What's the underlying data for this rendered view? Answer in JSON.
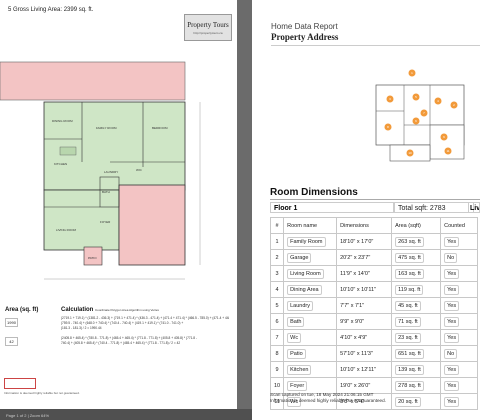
{
  "left_page": {
    "gla_text": "5 Gross Living Area: 2399 sq. ft.",
    "logo": {
      "title": "Property Tours",
      "url": "http://propertytours.ca"
    },
    "room_labels": [
      "DINING ROOM",
      "FAMILY ROOM",
      "BEDROOM",
      "KITCHEN",
      "W/C",
      "LAUNDRY",
      "BATH",
      "FOYER",
      "LIVING ROOM",
      "PATIO"
    ],
    "area_header": "Area (sq. ft)",
    "calc_header": "Calculation",
    "calc_subheader": "Coordinate Polygon Area Algorithm using Vertex",
    "areas": [
      {
        "value": "1990",
        "formula": "(2719.1 + 719.1) * (1381.2 - 436.3) + (719.1 + 471.4) * (436.3 - 471.4) + (471.4 + 471.4) * (466.5 - 785.0) + (471.4 + 448.4) * (785.0 - 785.0) + (448.4 + 542.8) * (785.9 - 785.9) + (542.8 + 542.8) *"
      },
      {
        "value": "42",
        "formula": "(2405.8 + 465.4) * (780.8 - 771.8) + (465.4 + 465.4) * (771.8 - 771.8) + (405.8 + 405.8) * (771.8 -"
      }
    ],
    "footnote": "Information is deemed highly reliable but not guaranteed.",
    "status_bar": "Page 1 of 2   |   Zoom 64%"
  },
  "right_page": {
    "subtitle": "Home Data Report",
    "title": "Property Address",
    "section_title": "Room Dimensions",
    "floor_label": "Floor 1",
    "total_label": "Total sqft:",
    "total_value": "2783",
    "liv_label": "Liv",
    "columns": [
      "#",
      "Room name",
      "Dimensions",
      "Area (sqft)",
      "Counted"
    ],
    "rooms": [
      {
        "n": "1",
        "name": "Family Room",
        "dim": "18'10\" x 17'0\"",
        "area": "263 sq. ft",
        "counted": "Yes"
      },
      {
        "n": "2",
        "name": "Garage",
        "dim": "20'2\" x 23'7\"",
        "area": "475 sq. ft",
        "counted": "No"
      },
      {
        "n": "3",
        "name": "Living Room",
        "dim": "11'9\" x 14'0\"",
        "area": "163 sq. ft",
        "counted": "Yes"
      },
      {
        "n": "4",
        "name": "Dining Area",
        "dim": "10'10\" x 10'11\"",
        "area": "119 sq. ft",
        "counted": "Yes"
      },
      {
        "n": "5",
        "name": "Laundry",
        "dim": "7'7\" x 7'1\"",
        "area": "45 sq. ft",
        "counted": "Yes"
      },
      {
        "n": "6",
        "name": "Bath",
        "dim": "9'9\" x 9'0\"",
        "area": "71 sq. ft",
        "counted": "Yes"
      },
      {
        "n": "7",
        "name": "Wc",
        "dim": "4'10\" x 4'9\"",
        "area": "23 sq. ft",
        "counted": "Yes"
      },
      {
        "n": "8",
        "name": "Patio",
        "dim": "57'10\" x 11'3\"",
        "area": "651 sq. ft",
        "counted": "No"
      },
      {
        "n": "9",
        "name": "Kitchen",
        "dim": "10'10\" x 12'11\"",
        "area": "139 sq. ft",
        "counted": "Yes"
      },
      {
        "n": "10",
        "name": "Foyer",
        "dim": "19'0\" x 26'0\"",
        "area": "278 sq. ft",
        "counted": "Yes"
      },
      {
        "n": "11",
        "name": "Wc",
        "dim": "3'8\" x 5'4\"",
        "area": "20 sq. ft",
        "counted": "Yes"
      }
    ],
    "footer_line1": "Scan captured on tue, 18 May 2024 21:06:15 GMT",
    "footer_line2": "Information is deemed highly reliable but not guaranteed.",
    "markers": [
      "1",
      "2",
      "3",
      "4",
      "5",
      "6",
      "7",
      "8",
      "9",
      "10",
      "11"
    ]
  },
  "colors": {
    "room_green": "#cfe6c6",
    "garage_pink": "#f3c4c4",
    "marker_orange": "#f29a3a",
    "background": "#6b6b6b"
  }
}
